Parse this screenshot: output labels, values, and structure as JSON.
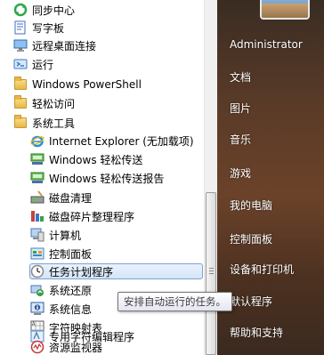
{
  "program_list": {
    "items": [
      {
        "label": "同步中心",
        "icon": "sync-center-icon",
        "color": "#2fa64a"
      },
      {
        "label": "写字板",
        "icon": "wordpad-icon",
        "color": "#3c6ec8"
      },
      {
        "label": "远程桌面连接",
        "icon": "remote-desktop-icon",
        "color": "#2f6db5"
      },
      {
        "label": "运行",
        "icon": "run-icon",
        "color": "#3a78c8"
      },
      {
        "label": "Windows PowerShell",
        "icon": "folder-icon",
        "color": "#e8b646"
      },
      {
        "label": "轻松访问",
        "icon": "folder-icon",
        "color": "#e8b646"
      },
      {
        "label": "系统工具",
        "icon": "folder-icon",
        "color": "#e8b646"
      },
      {
        "label": "Internet Explorer (无加载项)",
        "icon": "internet-explorer-icon",
        "color": "#2a8ee0"
      },
      {
        "label": "Windows 轻松传送",
        "icon": "easy-transfer-icon",
        "color": "#3fae3a"
      },
      {
        "label": "Windows 轻松传送报告",
        "icon": "easy-transfer-report-icon",
        "color": "#3fae3a"
      },
      {
        "label": "磁盘清理",
        "icon": "disk-cleanup-icon",
        "color": "#6b6b6b"
      },
      {
        "label": "磁盘碎片整理程序",
        "icon": "defragmenter-icon",
        "color": "#c2463e"
      },
      {
        "label": "计算机",
        "icon": "computer-icon",
        "color": "#4a7ab8"
      },
      {
        "label": "控制面板",
        "icon": "control-panel-icon",
        "color": "#3d86c6"
      },
      {
        "label": "任务计划程序",
        "icon": "task-scheduler-icon",
        "color": "#888888"
      },
      {
        "label": "系统还原",
        "icon": "system-restore-icon",
        "color": "#3a9a4a"
      },
      {
        "label": "系统信息",
        "icon": "system-information-icon",
        "color": "#2a5aa8"
      },
      {
        "label": "字符映射表",
        "icon": "character-map-icon",
        "color": "#555555"
      },
      {
        "label": "专用字符编辑程序",
        "icon": "private-character-editor-icon",
        "color": "#4a8ac8"
      },
      {
        "label": "资源监视器",
        "icon": "resource-monitor-icon",
        "color": "#c83232"
      }
    ],
    "selected_label": "任务计划程序"
  },
  "right_pane": {
    "items": [
      {
        "label": "Administrator"
      },
      {
        "label": "文档"
      },
      {
        "label": "图片"
      },
      {
        "label": "音乐"
      },
      {
        "label": "游戏"
      },
      {
        "label": "我的电脑"
      },
      {
        "label": "控制面板"
      },
      {
        "label": "设备和打印机"
      },
      {
        "label": "默认程序"
      },
      {
        "label": "帮助和支持"
      }
    ]
  },
  "tooltip": {
    "text": "安排自动运行的任务。"
  },
  "colors": {
    "selection_border": "#7da2ce",
    "right_pane_bg": "#5a3b28"
  }
}
